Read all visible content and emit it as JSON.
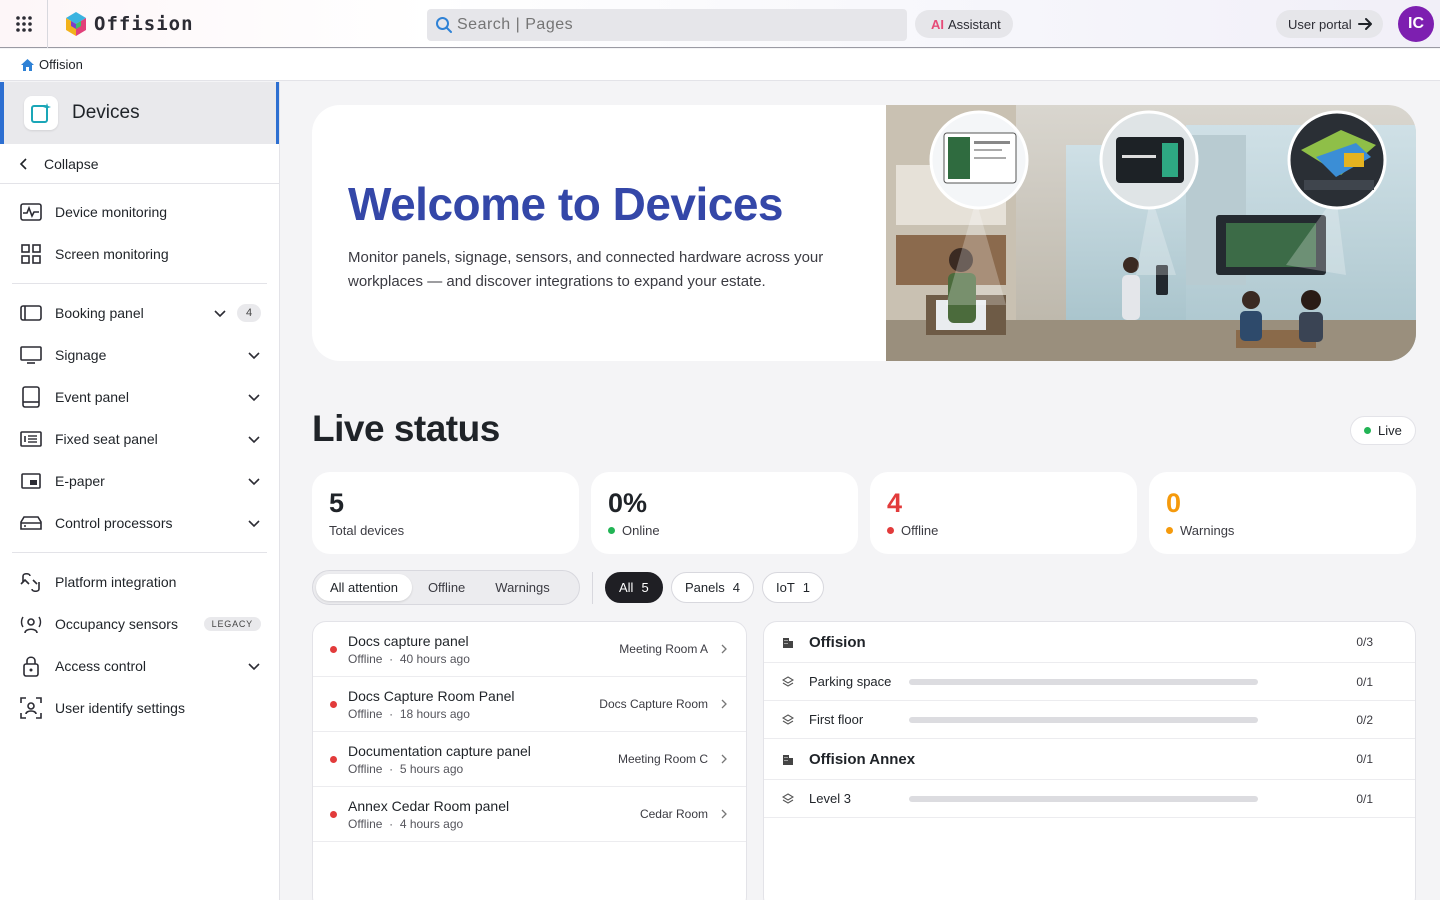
{
  "app": {
    "name": "Offision"
  },
  "search": {
    "placeholder": "Search | Pages"
  },
  "header": {
    "assistant_ai": "AI",
    "assistant_label": "Assistant",
    "user_portal": "User portal",
    "avatar_initials": "IC"
  },
  "breadcrumb": {
    "home": "Offision"
  },
  "sidebar": {
    "title": "Devices",
    "collapse": "Collapse",
    "group1": [
      {
        "label": "Device monitoring",
        "icon": "pulse-monitor-icon"
      },
      {
        "label": "Screen monitoring",
        "icon": "grid-icon"
      }
    ],
    "group2": [
      {
        "label": "Booking panel",
        "icon": "panel-icon",
        "badge": "4"
      },
      {
        "label": "Signage",
        "icon": "monitor-icon"
      },
      {
        "label": "Event panel",
        "icon": "tablet-icon"
      },
      {
        "label": "Fixed seat panel",
        "icon": "list-panel-icon"
      },
      {
        "label": "E-paper",
        "icon": "epaper-icon"
      },
      {
        "label": "Control processors",
        "icon": "processor-icon"
      }
    ],
    "group3": [
      {
        "label": "Platform integration",
        "icon": "integration-icon"
      },
      {
        "label": "Occupancy sensors",
        "icon": "sensor-icon",
        "tag": "LEGACY"
      },
      {
        "label": "Access control",
        "icon": "lock-icon"
      },
      {
        "label": "User identify settings",
        "icon": "face-scan-icon"
      }
    ]
  },
  "hero": {
    "title": "Welcome to Devices",
    "description": "Monitor panels, signage, sensors, and connected hardware across your workplaces — and discover integrations to expand your estate."
  },
  "live": {
    "title": "Live status",
    "pill": "Live",
    "colors": {
      "online": "#22b455",
      "offline": "#e23b3b",
      "warning": "#f59a0c"
    },
    "stats": [
      {
        "value": "5",
        "label": "Total devices"
      },
      {
        "value": "0%",
        "label": "Online"
      },
      {
        "value": "4",
        "label": "Offline"
      },
      {
        "value": "0",
        "label": "Warnings"
      }
    ]
  },
  "filters": {
    "segments": [
      "All attention",
      "Offline",
      "Warnings"
    ],
    "chips": [
      {
        "label": "All",
        "count": "5"
      },
      {
        "label": "Panels",
        "count": "4"
      },
      {
        "label": "IoT",
        "count": "1"
      }
    ]
  },
  "alerts": [
    {
      "name": "Docs capture panel",
      "status": "Offline",
      "time": "40 hours ago",
      "room": "Meeting Room A"
    },
    {
      "name": "Docs Capture Room Panel",
      "status": "Offline",
      "time": "18 hours ago",
      "room": "Docs Capture Room"
    },
    {
      "name": "Documentation capture panel",
      "status": "Offline",
      "time": "5 hours ago",
      "room": "Meeting Room C"
    },
    {
      "name": "Annex Cedar Room panel",
      "status": "Offline",
      "time": "4 hours ago",
      "room": "Cedar Room"
    }
  ],
  "locations": [
    {
      "type": "building",
      "name": "Offision",
      "count": "0/3"
    },
    {
      "type": "floor",
      "name": "Parking space",
      "count": "0/1",
      "fraction": 0
    },
    {
      "type": "floor",
      "name": "First floor",
      "count": "0/2",
      "fraction": 0
    },
    {
      "type": "building",
      "name": "Offision Annex",
      "count": "0/1"
    },
    {
      "type": "floor",
      "name": "Level 3",
      "count": "0/1",
      "fraction": 0
    }
  ],
  "separator": "·"
}
